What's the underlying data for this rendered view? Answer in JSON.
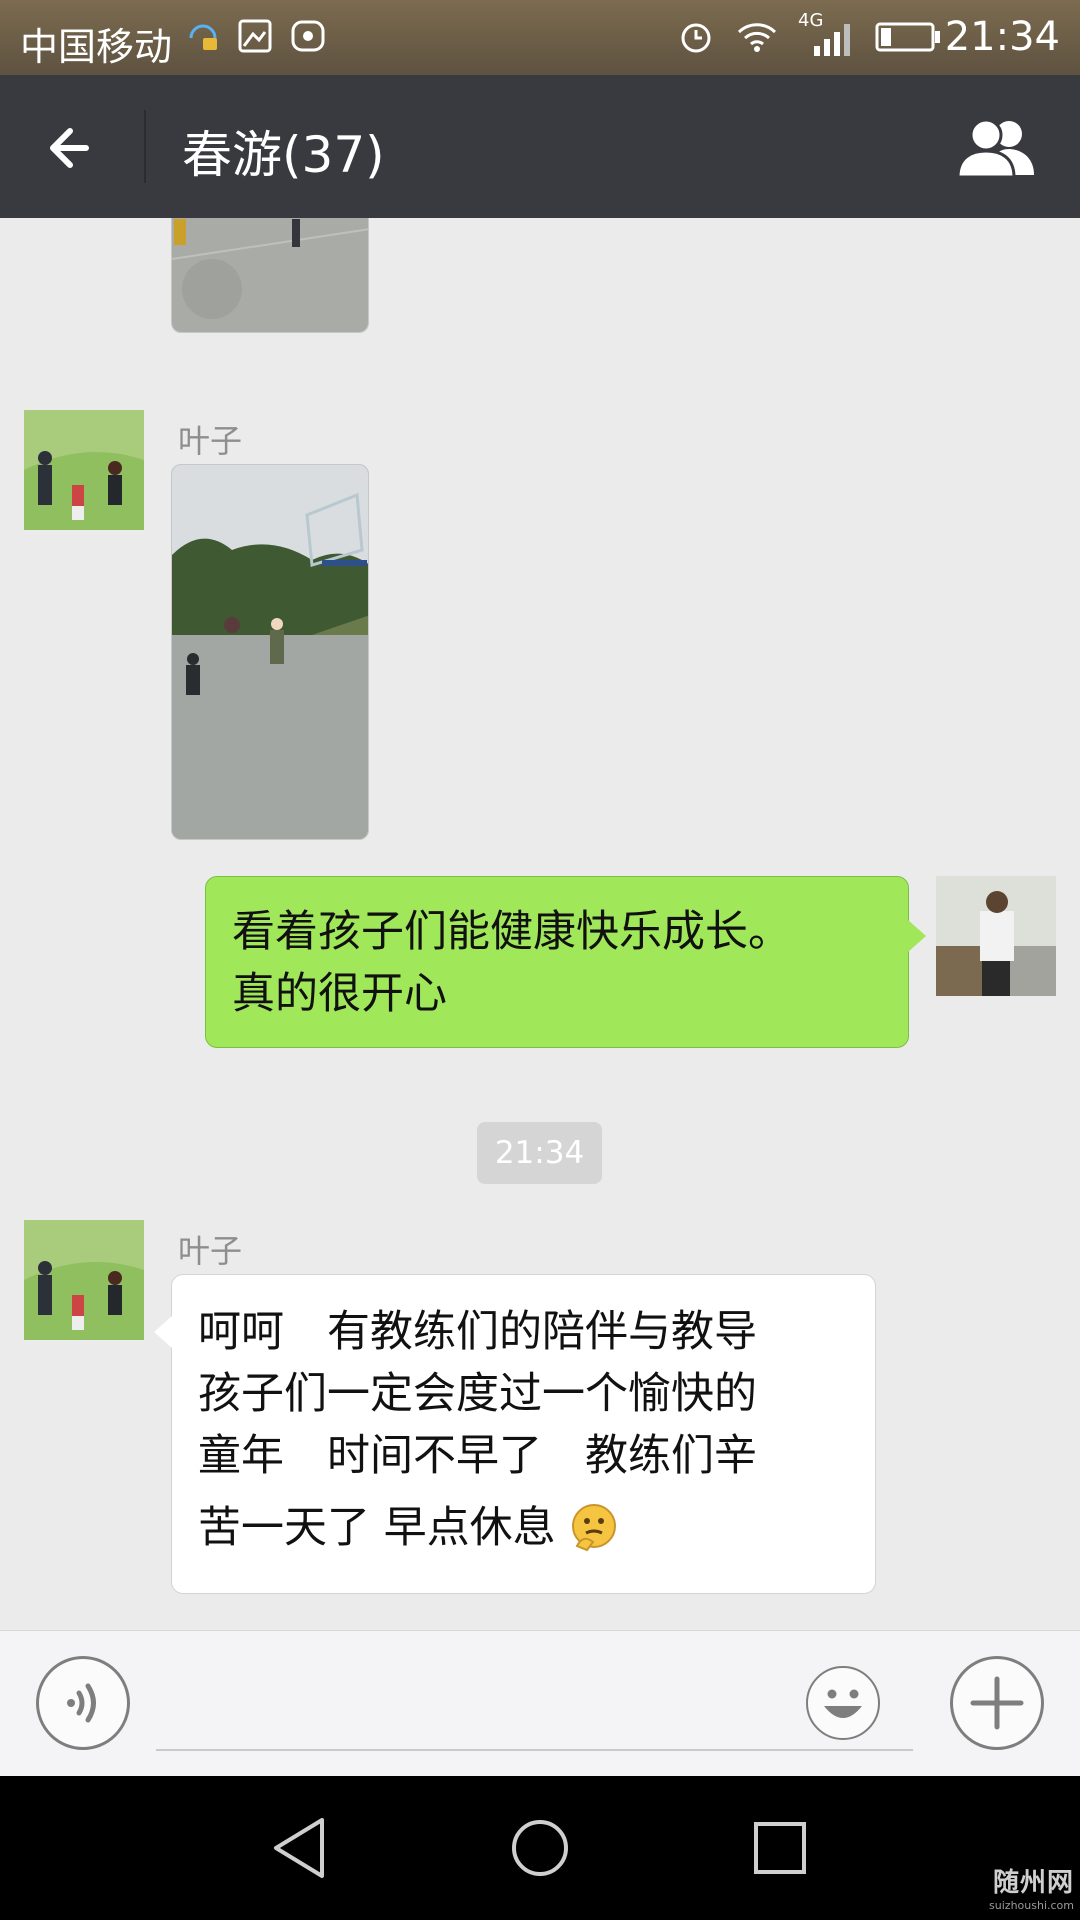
{
  "status_bar": {
    "carrier": "中国移动",
    "network": "4G",
    "time": "21:34"
  },
  "title_bar": {
    "title": "春游(37)"
  },
  "messages": [
    {
      "type": "image",
      "sender": "other",
      "partial": true,
      "depicts": "basketball court photo"
    },
    {
      "type": "image",
      "sender": "other",
      "nickname": "叶子",
      "depicts": "children playing on basketball court"
    },
    {
      "type": "text",
      "sender": "self",
      "text_lines": [
        "看着孩子们能健康快乐成长。",
        "真的很开心"
      ]
    },
    {
      "type": "time",
      "text": "21:34"
    },
    {
      "type": "text",
      "sender": "other",
      "nickname": "叶子",
      "text_lines": [
        "呵呵　有教练们的陪伴与教导",
        "孩子们一定会度过一个愉快的",
        "童年　时间不早了　教练们辛",
        "苦一天了 早点休息"
      ],
      "emoji": "thinking-face-emoji"
    }
  ],
  "input_bar": {
    "voice_icon": "voice-icon",
    "emoji_icon": "smiley-icon",
    "more_icon": "plus-icon"
  },
  "watermark": {
    "main": "随州网",
    "sub": "suizhoushi.com"
  },
  "colors": {
    "title_bar": "#393a3f",
    "chat_bg": "#ebebeb",
    "bubble_self": "#a0e75a",
    "bubble_other": "#ffffff"
  }
}
